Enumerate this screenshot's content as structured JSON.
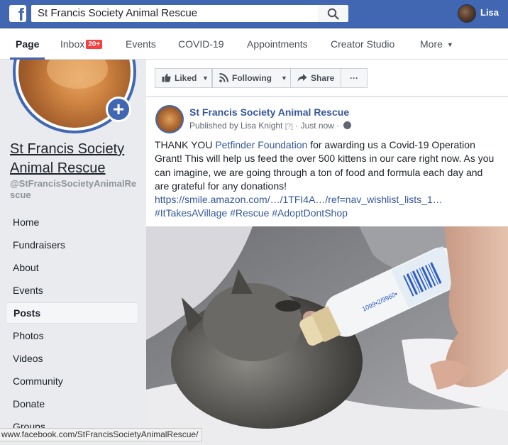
{
  "topbar": {
    "search_value": "St Francis Society Animal Rescue",
    "user_name": "Lisa"
  },
  "tabs": [
    {
      "label": "Page"
    },
    {
      "label": "Inbox",
      "badge": "20+"
    },
    {
      "label": "Events"
    },
    {
      "label": "COVID-19"
    },
    {
      "label": "Appointments"
    },
    {
      "label": "Creator Studio"
    },
    {
      "label": "More"
    }
  ],
  "sidebar": {
    "page_name": "St Francis Society Animal Rescue",
    "handle": "@StFrancisSocietyAnimalRescue",
    "items": [
      {
        "label": "Home"
      },
      {
        "label": "Fundraisers"
      },
      {
        "label": "About"
      },
      {
        "label": "Events"
      },
      {
        "label": "Posts"
      },
      {
        "label": "Photos"
      },
      {
        "label": "Videos"
      },
      {
        "label": "Community"
      },
      {
        "label": "Donate"
      },
      {
        "label": "Groups"
      }
    ]
  },
  "actions": {
    "liked": "Liked",
    "following": "Following",
    "share": "Share",
    "more": "···"
  },
  "post": {
    "author": "St Francis Society Animal Rescue",
    "published_by": "Published by Lisa Knight",
    "help": "[?]",
    "time": "· Just now ·",
    "text_1": "THANK YOU ",
    "mention": "Petfinder Foundation",
    "text_2": " for awarding us a Covid-19 Operation Grant! This will help us feed the over 500 kittens in our care right now. As you can imagine, we are going through a ton of food and formula each day and are grateful for any donations! ",
    "url": "https://smile.amazon.com/…/1TFI4A…/ref=nav_wishlist_lists_1…",
    "hashtags": "#ItTakesAVillage #Rescue #AdoptDontShop",
    "bottle_label": "1099•2/9960•"
  },
  "status_url": "www.facebook.com/StFrancisSocietyAnimalRescue/",
  "colors": {
    "brand_blue": "#4267b2",
    "link_blue": "#365899",
    "badge_red": "#fa3e3e"
  }
}
